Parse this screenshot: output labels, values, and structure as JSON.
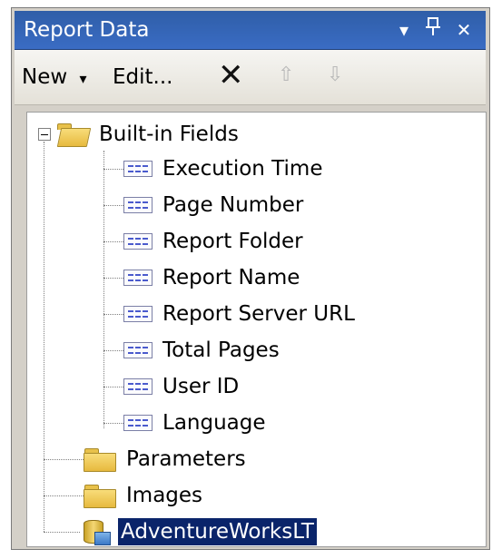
{
  "window": {
    "title": "Report Data",
    "dropdown_glyph": "▾",
    "pin_glyph": "📌",
    "close_glyph": "✕"
  },
  "toolbar": {
    "new_label": "New",
    "new_arrow": "▾",
    "edit_label": "Edit...",
    "delete_glyph": "✕",
    "move_up_glyph": "⇧",
    "move_down_glyph": "⇩"
  },
  "tree": {
    "builtin": {
      "label": "Built-in Fields",
      "expanded": true,
      "items": [
        {
          "label": "Execution Time"
        },
        {
          "label": "Page Number"
        },
        {
          "label": "Report Folder"
        },
        {
          "label": "Report Name"
        },
        {
          "label": "Report Server URL"
        },
        {
          "label": "Total Pages"
        },
        {
          "label": "User ID"
        },
        {
          "label": "Language"
        }
      ]
    },
    "parameters": {
      "label": "Parameters"
    },
    "images": {
      "label": "Images"
    },
    "datasource": {
      "label": "AdventureWorksLT",
      "selected": true
    }
  },
  "colors": {
    "title_bar": "#3a6cc4",
    "selection": "#0a246a",
    "folder": "#e7b93e"
  },
  "icons": {
    "folder_open": "folder-open-icon",
    "folder": "folder-icon",
    "field": "field-icon",
    "datasource": "datasource-icon",
    "collapse": "collapse-icon"
  }
}
